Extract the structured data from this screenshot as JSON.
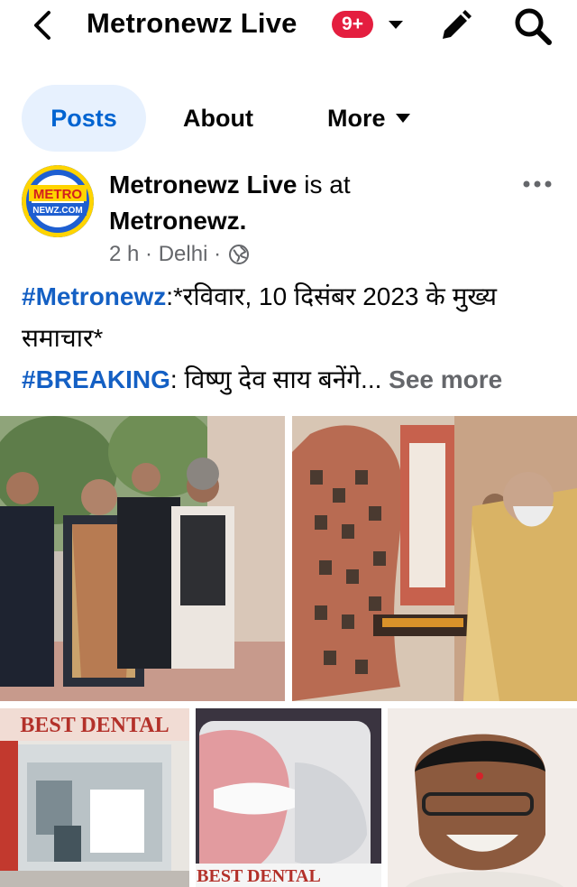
{
  "header": {
    "title": "Metronewz Live",
    "notification_badge": "9+",
    "icons": [
      "back-arrow-icon",
      "caret-down-icon",
      "pencil-icon",
      "search-icon"
    ]
  },
  "tabs": [
    {
      "label": "Posts",
      "selected": true
    },
    {
      "label": "About",
      "selected": false
    },
    {
      "label": "More",
      "selected": false
    }
  ],
  "post": {
    "avatar_logo_text": [
      "METRO",
      "NEWZ.COM"
    ],
    "author": "Metronewz Live",
    "is_at_text": "is at",
    "location_page": "Metronewz.",
    "time": "2 h",
    "separator": "·",
    "place": "Delhi",
    "text": {
      "hashtag1": "#Metronewz",
      "line1": ":*रविवार, 10 दिसंबर 2023 के मुख्य समाचार*",
      "hashtag2": "#BREAKING",
      "line2": ": विष्णु देव साय बनेंगे...",
      "see_more": "See more"
    },
    "photo_texts": {
      "dental_sign": "BEST DENTAL",
      "dental_screen": "BEST DENTAL"
    }
  },
  "colors": {
    "accent_blue": "#0064d1",
    "tab_bg": "#e7f1fe",
    "badge_red": "#e41e3f",
    "hashtag_blue": "#1460c4",
    "secondary_text": "#65676b"
  }
}
